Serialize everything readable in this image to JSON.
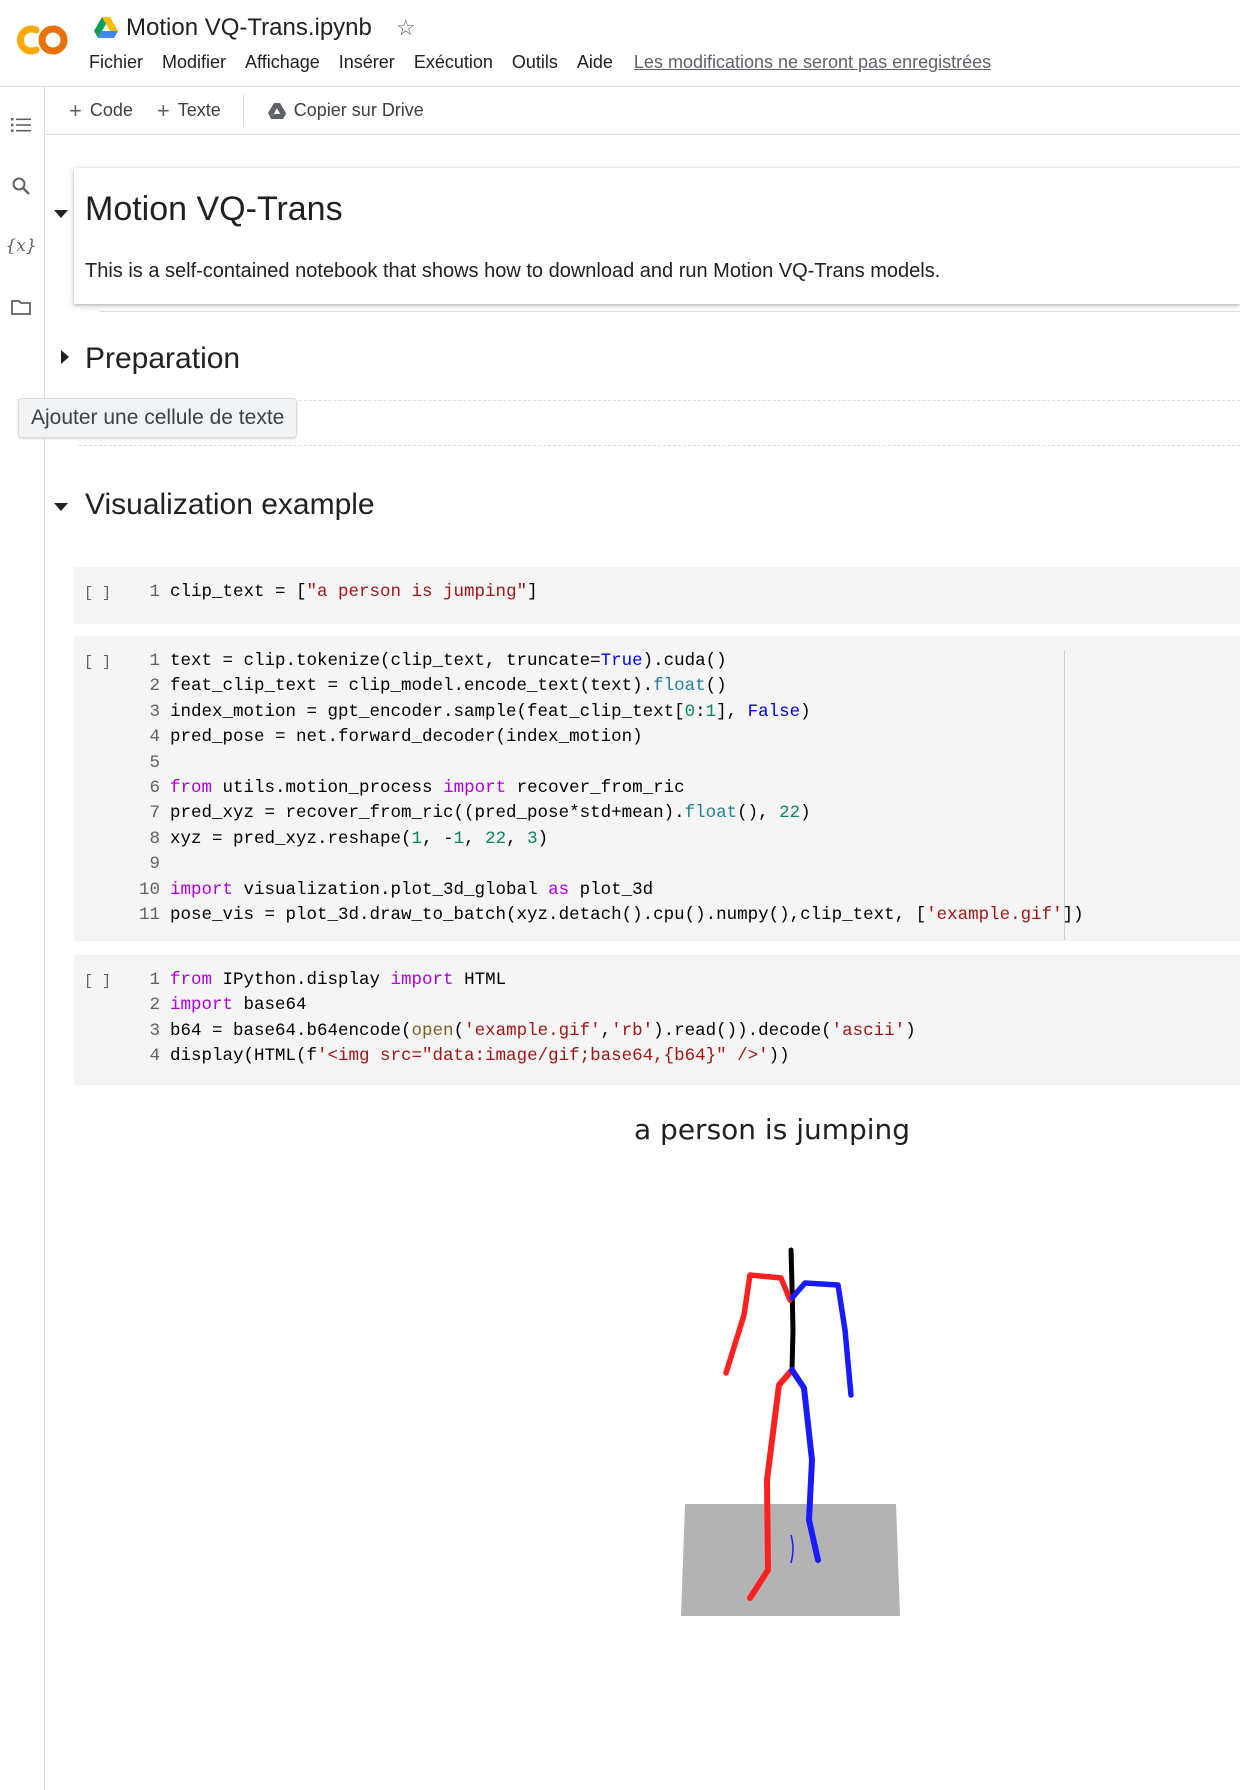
{
  "header": {
    "app_logo": "CO",
    "notebook_title": "Motion VQ-Trans.ipynb",
    "menu": [
      "Fichier",
      "Modifier",
      "Affichage",
      "Insérer",
      "Exécution",
      "Outils",
      "Aide"
    ],
    "unsaved_notice": "Les modifications ne seront pas enregistrées"
  },
  "left_rail": {
    "icons": [
      "table-of-contents-icon",
      "search-icon",
      "variables-icon",
      "files-icon"
    ],
    "variables_label": "{x}"
  },
  "toolbar": {
    "add_code": "Code",
    "add_text": "Texte",
    "copy_drive": "Copier sur Drive"
  },
  "cells": {
    "intro": {
      "title": "Motion VQ-Trans",
      "body": "This is a self-contained notebook that shows how to download and run Motion VQ-Trans models."
    },
    "preparation": {
      "title": "Preparation"
    },
    "tooltip": "Ajouter une cellule de texte",
    "visualization": {
      "title": "Visualization example"
    },
    "run_button_label": "[ ]",
    "code_cell_1": [
      "clip_text = [\"a person is jumping\"]"
    ],
    "code_cell_2": [
      "text = clip.tokenize(clip_text, truncate=True).cuda()",
      "feat_clip_text = clip_model.encode_text(text).float()",
      "index_motion = gpt_encoder.sample(feat_clip_text[0:1], False)",
      "pred_pose = net.forward_decoder(index_motion)",
      "",
      "from utils.motion_process import recover_from_ric",
      "pred_xyz = recover_from_ric((pred_pose*std+mean).float(), 22)",
      "xyz = pred_xyz.reshape(1, -1, 22, 3)",
      "",
      "import visualization.plot_3d_global as plot_3d",
      "pose_vis = plot_3d.draw_to_batch(xyz.detach().cpu().numpy(),clip_text, ['example.gif'])"
    ],
    "code_cell_3": [
      "from IPython.display import HTML",
      "import base64",
      "b64 = base64.b64encode(open('example.gif','rb').read()).decode('ascii')",
      "display(HTML(f'<img src=\"data:image/gif;base64,{b64}\" />'))"
    ]
  },
  "output": {
    "title": "a person is jumping",
    "colors": {
      "left_limbs": "#ff2020",
      "right_limbs": "#1a1aff",
      "spine": "#000000",
      "floor": "#b3b3b3"
    }
  }
}
